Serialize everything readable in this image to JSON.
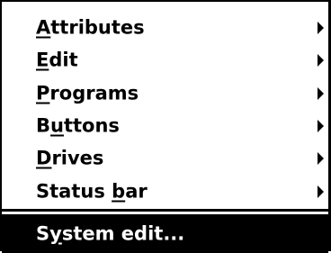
{
  "menu": {
    "items": [
      {
        "label_accel": "A",
        "label_rest": "ttributes",
        "has_submenu": true,
        "submenu_icon": "triangle-right-icon"
      },
      {
        "label_accel": "E",
        "label_rest": "dit",
        "has_submenu": true,
        "submenu_icon": "triangle-right-icon"
      },
      {
        "label_accel": "P",
        "label_rest": "rograms",
        "has_submenu": true,
        "submenu_icon": "triangle-right-icon"
      },
      {
        "label_pre": "B",
        "label_accel": "u",
        "label_rest": "ttons",
        "has_submenu": true,
        "submenu_icon": "triangle-right-icon"
      },
      {
        "label_accel": "D",
        "label_rest": "rives",
        "has_submenu": true,
        "submenu_icon": "triangle-right-icon"
      },
      {
        "label_pre": "Status ",
        "label_accel": "b",
        "label_rest": "ar",
        "has_submenu": true,
        "submenu_icon": "triangle-right-icon"
      }
    ],
    "selected_item": {
      "label_pre": "S",
      "label_accel": "y",
      "label_rest": "stem edit...",
      "highlight_color": "#000000",
      "text_color": "#ffffff"
    }
  }
}
